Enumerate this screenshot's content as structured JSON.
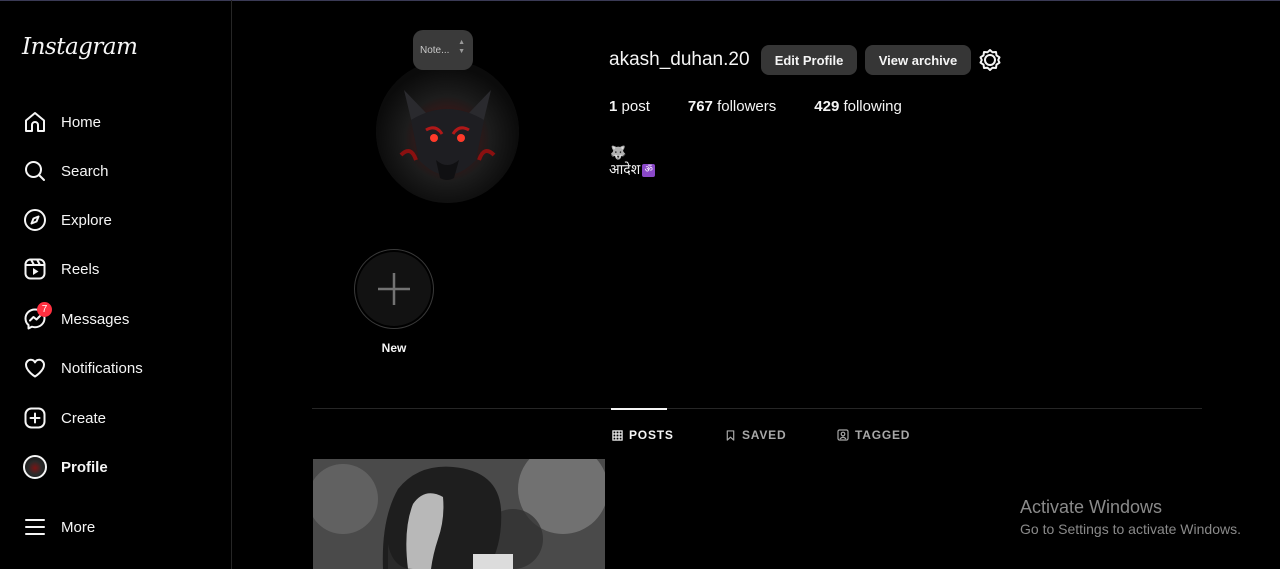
{
  "app": {
    "logo_text": "Instagram"
  },
  "sidebar": {
    "items": [
      {
        "key": "home",
        "label": "Home",
        "icon": "home-icon"
      },
      {
        "key": "search",
        "label": "Search",
        "icon": "search-icon"
      },
      {
        "key": "explore",
        "label": "Explore",
        "icon": "compass-icon"
      },
      {
        "key": "reels",
        "label": "Reels",
        "icon": "reels-icon"
      },
      {
        "key": "messages",
        "label": "Messages",
        "icon": "messenger-icon",
        "badge": "7"
      },
      {
        "key": "notifications",
        "label": "Notifications",
        "icon": "heart-icon"
      },
      {
        "key": "create",
        "label": "Create",
        "icon": "plus-square-icon"
      },
      {
        "key": "profile",
        "label": "Profile",
        "icon": "profile-avatar"
      },
      {
        "key": "more",
        "label": "More",
        "icon": "hamburger-menu-icon"
      }
    ]
  },
  "profile": {
    "note_text": "Note...",
    "username": "akash_duhan.20",
    "edit_profile_label": "Edit Profile",
    "view_archive_label": "View archive",
    "stats": {
      "posts_count": "1",
      "posts_label": "post",
      "followers_count": "767",
      "followers_label": "followers",
      "following_count": "429",
      "following_label": "following"
    },
    "bio_emoji": "🐺",
    "bio_text": "आदेश",
    "bio_symbol": "ॐ"
  },
  "highlights": {
    "new_label": "New"
  },
  "tabs": {
    "posts": "POSTS",
    "saved": "SAVED",
    "tagged": "TAGGED"
  },
  "windows_watermark": {
    "title": "Activate Windows",
    "subtitle": "Go to Settings to activate Windows."
  },
  "colors": {
    "background": "#000000",
    "text": "#f5f5f5",
    "button_bg": "#363636",
    "badge": "#ff3040",
    "muted": "#a8a8a8"
  }
}
